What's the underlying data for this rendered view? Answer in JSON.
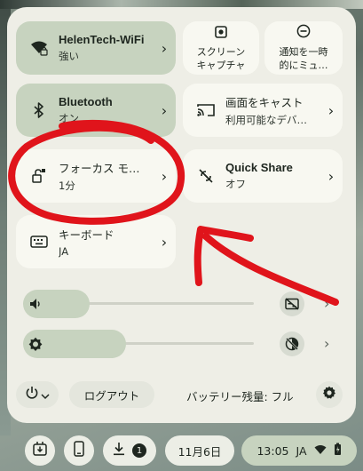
{
  "tiles": {
    "wifi": {
      "title": "HelenTech-WiFi",
      "subtitle": "強い",
      "icon": "wifi-lock-icon"
    },
    "screen_capture": {
      "label": "スクリーン\nキャプチャ",
      "icon": "screen-capture-icon"
    },
    "do_not_disturb": {
      "label": "通知を一時\n的にミュ…",
      "icon": "do-not-disturb-icon"
    },
    "bluetooth": {
      "title": "Bluetooth",
      "subtitle": "オン",
      "icon": "bluetooth-icon"
    },
    "cast": {
      "title": "画面をキャスト",
      "subtitle": "利用可能なデバ…",
      "icon": "cast-icon"
    },
    "focus": {
      "title": "フォーカス モ…",
      "subtitle": "1分",
      "icon": "focus-mode-icon"
    },
    "quick_share": {
      "title": "Quick Share",
      "subtitle": "オフ",
      "icon": "quick-share-icon"
    },
    "keyboard": {
      "title": "キーボード",
      "subtitle": "JA",
      "icon": "keyboard-icon"
    }
  },
  "sliders": {
    "volume": {
      "level": 0.26,
      "icon": "volume-icon",
      "side_icon": "captions-off-icon"
    },
    "brightness": {
      "level": 0.42,
      "icon": "brightness-icon",
      "side_icon": "night-light-off-icon"
    }
  },
  "footer": {
    "logout_label": "ログアウト",
    "battery_text": "バッテリー残量: フル"
  },
  "shelf": {
    "download_count": "1",
    "date": "11月6日",
    "time": "13:05",
    "ime": "JA"
  },
  "colors": {
    "panel_bg": "#eeeee6",
    "tile_on": "#c7d3bf",
    "tile_off": "#f8f8f1",
    "annotation": "#e0141b"
  }
}
